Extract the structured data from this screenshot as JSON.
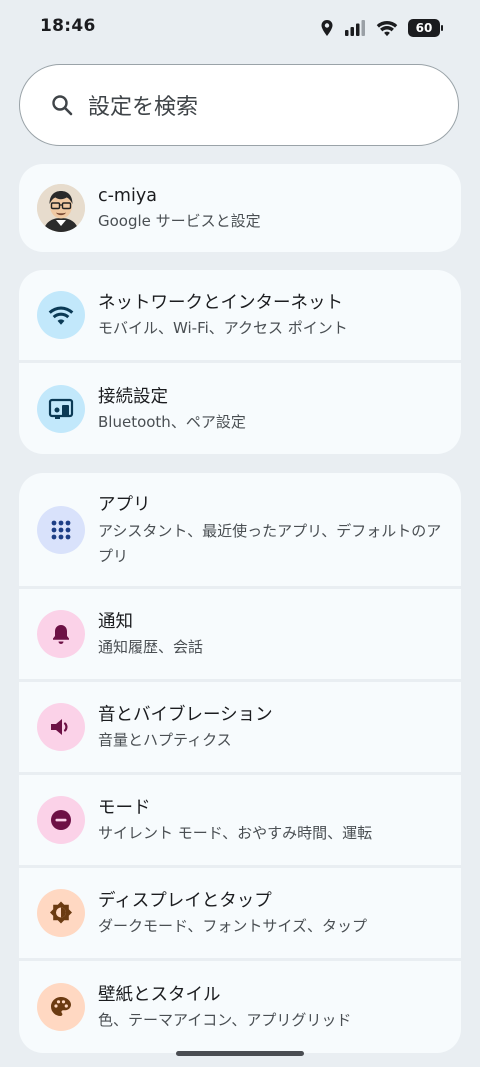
{
  "status": {
    "time": "18:46",
    "battery": "60"
  },
  "search": {
    "placeholder": "設定を検索"
  },
  "account": {
    "name": "c-miya",
    "subtitle": "Google サービスと設定"
  },
  "settings": [
    {
      "title": "ネットワークとインターネット",
      "subtitle": "モバイル、Wi-Fi、アクセス ポイント",
      "icon": "wifi-icon",
      "color": "#c2e8fb"
    },
    {
      "title": "接続設定",
      "subtitle": "Bluetooth、ペア設定",
      "icon": "connected-devices-icon",
      "color": "#c2e8fb"
    },
    {
      "title": "アプリ",
      "subtitle": "アシスタント、最近使ったアプリ、デフォルトのアプリ",
      "icon": "apps-grid-icon",
      "color": "#d9e2fb"
    },
    {
      "title": "通知",
      "subtitle": "通知履歴、会話",
      "icon": "bell-icon",
      "color": "#fbd2e8"
    },
    {
      "title": "音とバイブレーション",
      "subtitle": "音量とハプティクス",
      "icon": "speaker-icon",
      "color": "#fbd2e8"
    },
    {
      "title": "モード",
      "subtitle": "サイレント モード、おやすみ時間、運転",
      "icon": "do-not-disturb-icon",
      "color": "#fbd2e8"
    },
    {
      "title": "ディスプレイとタップ",
      "subtitle": "ダークモード、フォントサイズ、タップ",
      "icon": "brightness-icon",
      "color": "#ffd8c2"
    },
    {
      "title": "壁紙とスタイル",
      "subtitle": "色、テーマアイコン、アプリグリッド",
      "icon": "palette-icon",
      "color": "#ffd8c2"
    }
  ]
}
